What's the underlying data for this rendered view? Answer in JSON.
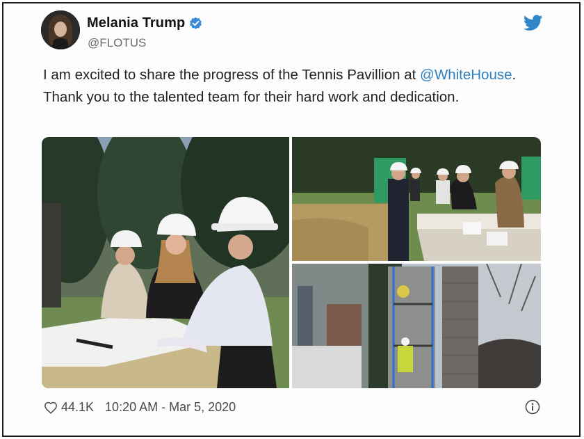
{
  "tweet": {
    "display_name": "Melania Trump",
    "handle": "@FLOTUS",
    "text_before": "I am excited to share the progress of the Tennis Pavillion at ",
    "mention": "@WhiteHouse",
    "text_after": ". Thank you to the talented team for their hard work and dedication.",
    "likes": "44.1K",
    "timestamp": "10:20 AM - Mar 5, 2020"
  },
  "icons": {
    "verified": "verified-badge-icon",
    "brand": "twitter-bird-icon",
    "like": "heart-icon",
    "info": "info-icon"
  },
  "colors": {
    "verified": "#3b8ad8",
    "brand": "#2f86c8",
    "mention": "#2f7fbf"
  },
  "media": {
    "count": 3
  }
}
